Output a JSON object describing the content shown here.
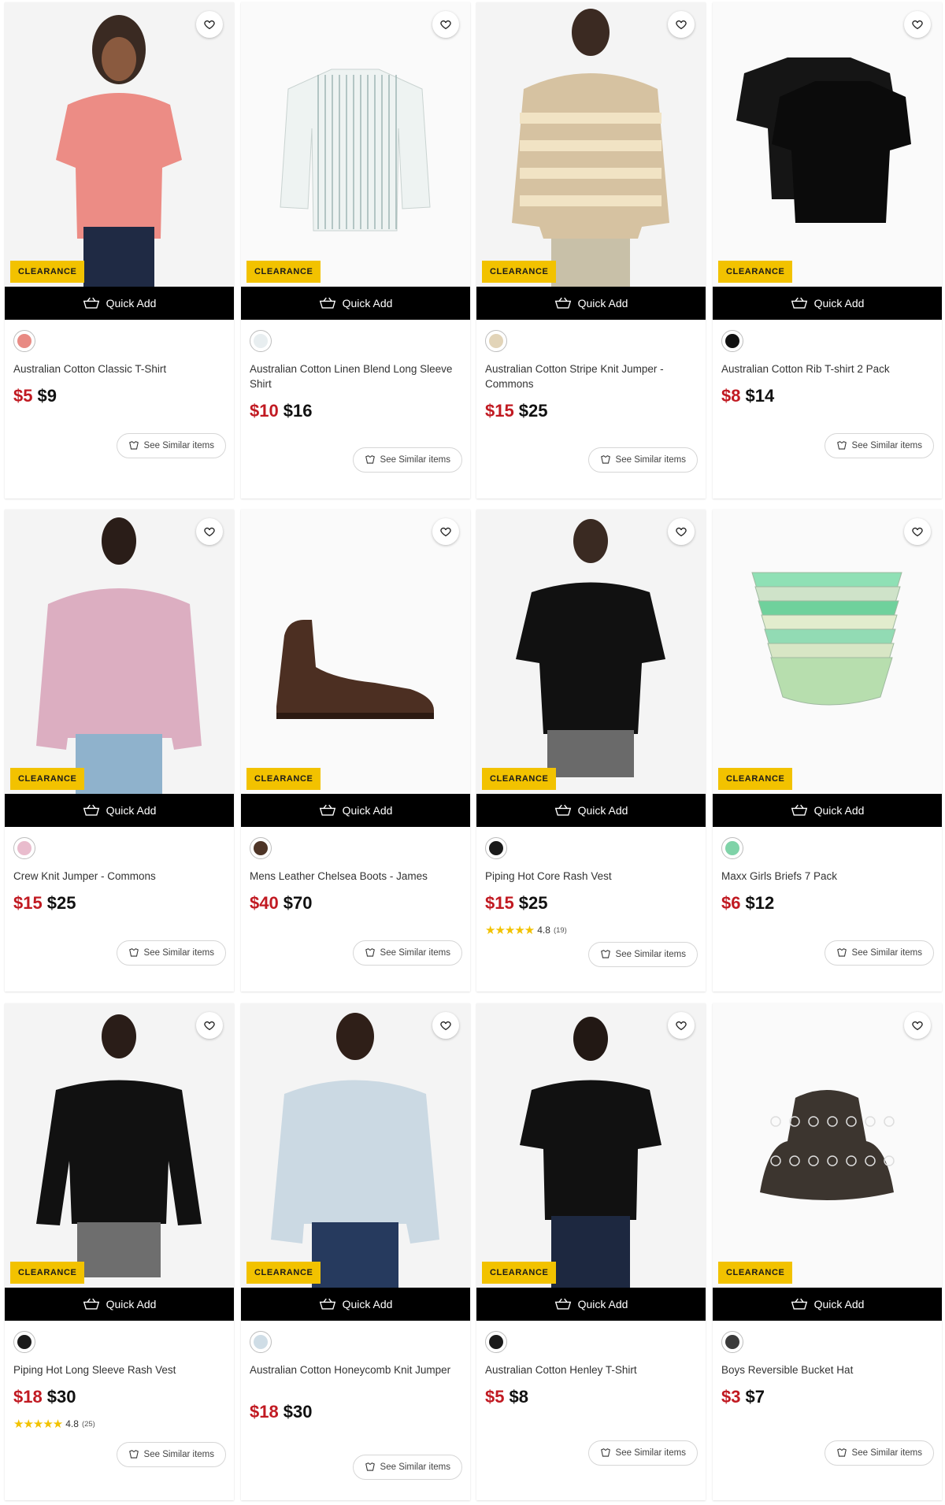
{
  "wishlist_label": "",
  "badge_label": "CLEARANCE",
  "quick_add_label": "Quick Add",
  "similar_label": "See Similar items",
  "products": [
    {
      "title": "Australian Cotton Classic T-Shirt",
      "sale": "$5",
      "orig": "$9",
      "swatch": "#e88a83"
    },
    {
      "title": "Australian Cotton Linen Blend Long Sleeve Shirt",
      "sale": "$10",
      "orig": "$16",
      "swatch": "#e8eef0"
    },
    {
      "title": "Australian Cotton Stripe Knit Jumper - Commons",
      "sale": "$15",
      "orig": "$25",
      "swatch": "#e2d4b8"
    },
    {
      "title": "Australian Cotton Rib T-shirt 2 Pack",
      "sale": "$8",
      "orig": "$14",
      "swatch": "#111111"
    },
    {
      "title": "Crew Knit Jumper - Commons",
      "sale": "$15",
      "orig": "$25",
      "swatch": "#e9bccd"
    },
    {
      "title": "Mens Leather Chelsea Boots - James",
      "sale": "$40",
      "orig": "$70",
      "swatch": "#4e3527"
    },
    {
      "title": "Piping Hot Core Rash Vest",
      "sale": "$15",
      "orig": "$25",
      "swatch": "#1a1a1a",
      "rating": "4.8",
      "reviews": "(19)",
      "stars": 5
    },
    {
      "title": "Maxx Girls Briefs 7 Pack",
      "sale": "$6",
      "orig": "$12",
      "swatch": "#7fd3a8"
    },
    {
      "title": "Piping Hot Long Sleeve Rash Vest",
      "sale": "$18",
      "orig": "$30",
      "swatch": "#1a1a1a",
      "rating": "4.8",
      "reviews": "(25)",
      "stars": 5
    },
    {
      "title": "Australian Cotton Honeycomb Knit Jumper",
      "sale": "$18",
      "orig": "$30",
      "swatch": "#cfdde6"
    },
    {
      "title": "Australian Cotton Henley T-Shirt",
      "sale": "$5",
      "orig": "$8",
      "swatch": "#1a1a1a"
    },
    {
      "title": "Boys Reversible Bucket Hat",
      "sale": "$3",
      "orig": "$7",
      "swatch": "#3a3a3a"
    }
  ],
  "colors": {
    "badge": "#f2c200",
    "sale_price": "#c11a22",
    "quick_add_bg": "#000000",
    "star": "#f2c200"
  }
}
